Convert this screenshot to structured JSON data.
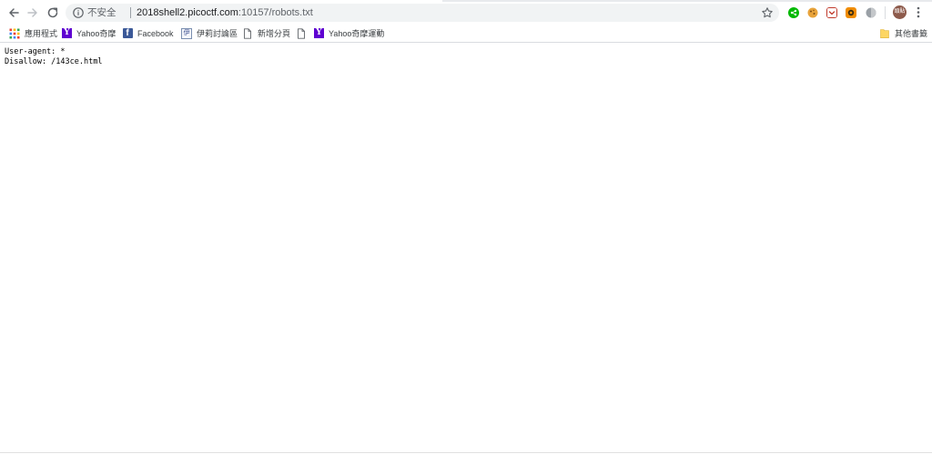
{
  "omnibox": {
    "security_label": "不安全",
    "url_host": "2018shell2.picoctf.com",
    "url_path": ":10157/robots.txt"
  },
  "profile": {
    "avatar_text": "頭貼"
  },
  "bookmarks": {
    "items": [
      {
        "label": "應用程式",
        "icon": "apps-grid-icon"
      },
      {
        "label": "Yahoo奇摩",
        "icon": "yahoo-icon"
      },
      {
        "label": "Facebook",
        "icon": "facebook-icon"
      },
      {
        "label": "伊莉討論區",
        "icon": "forum-icon"
      },
      {
        "label": "新增分頁",
        "icon": "page-icon"
      },
      {
        "label": "",
        "icon": "page-icon"
      },
      {
        "label": "Yahoo奇摩運動",
        "icon": "yahoo-icon"
      }
    ],
    "other_label": "其他書籤"
  },
  "page": {
    "lines": [
      "User-agent: *",
      "Disallow: /143ce.html"
    ]
  },
  "colors": {
    "yahoo": "#5f01d1",
    "facebook": "#3b5998",
    "line_ext": "#00b900",
    "folder": "#fdd663"
  }
}
